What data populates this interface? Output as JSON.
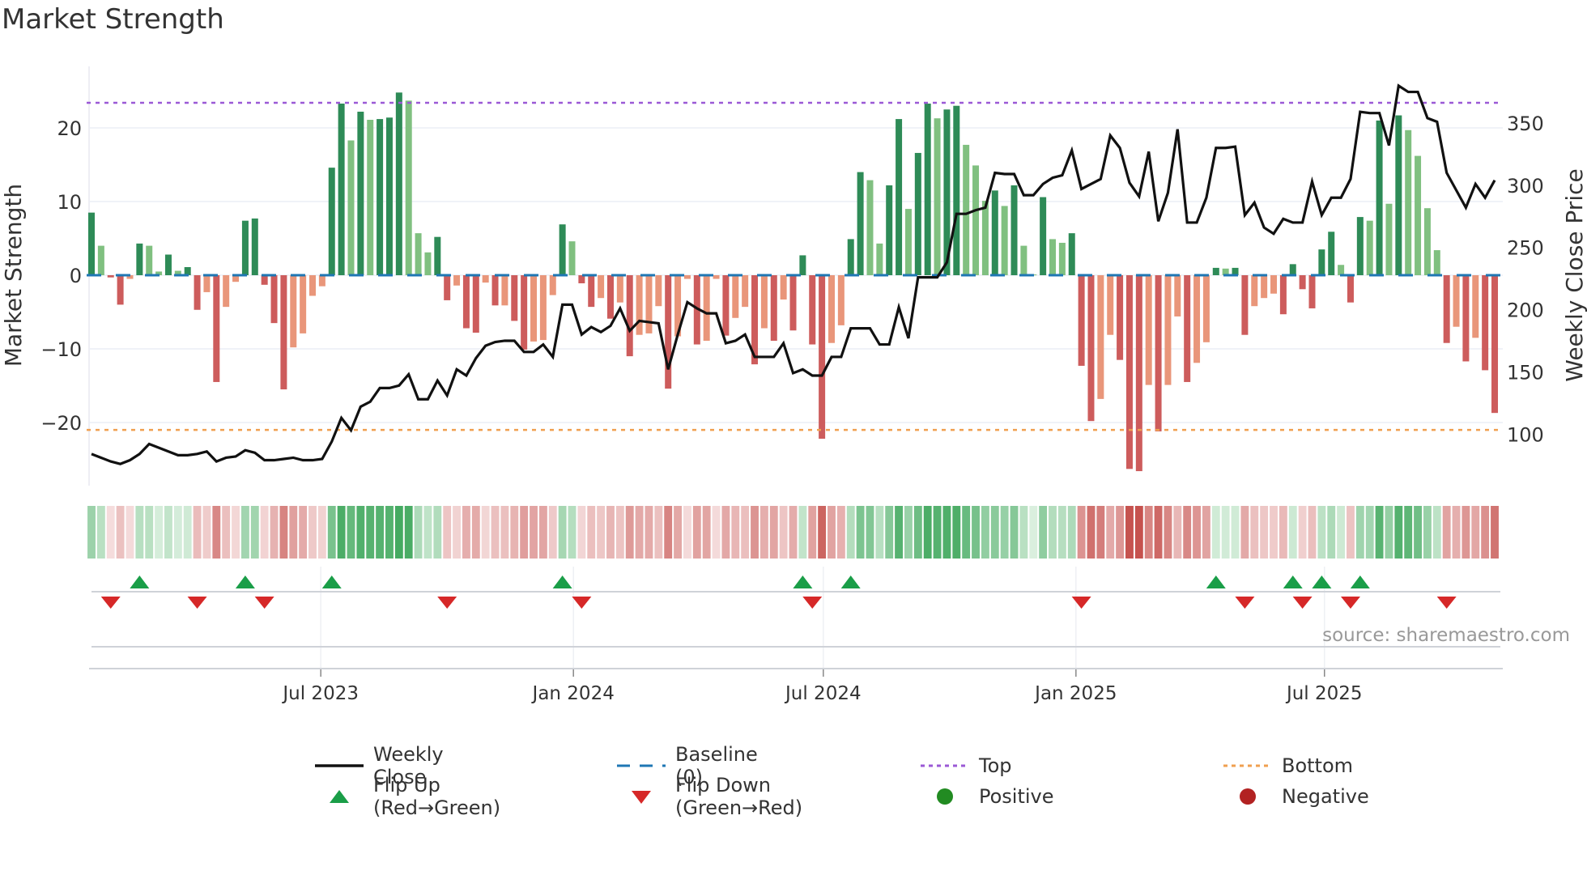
{
  "chart_data": {
    "type": "bar",
    "title": "Market Strength",
    "ylabel": "Market Strength",
    "y2label": "Weekly Close Price",
    "x_start": "2023-01-15",
    "x_interval": "weekly",
    "ylim": [
      -28,
      26
    ],
    "y2lim": [
      70,
      385
    ],
    "yticks": [
      {
        "v": 20,
        "label": "20"
      },
      {
        "v": 10,
        "label": "10"
      },
      {
        "v": 0,
        "label": "0"
      },
      {
        "v": -10,
        "label": "−10"
      },
      {
        "v": -20,
        "label": "−20"
      }
    ],
    "y2ticks": [
      {
        "v": 350,
        "label": "350"
      },
      {
        "v": 300,
        "label": "300"
      },
      {
        "v": 250,
        "label": "250"
      },
      {
        "v": 200,
        "label": "200"
      },
      {
        "v": 150,
        "label": "150"
      },
      {
        "v": 100,
        "label": "100"
      }
    ],
    "xticks": [
      {
        "date": "2023-07-01",
        "label": "Jul 2023"
      },
      {
        "date": "2024-01-01",
        "label": "Jan 2024"
      },
      {
        "date": "2024-07-01",
        "label": "Jul 2024"
      },
      {
        "date": "2025-01-01",
        "label": "Jan 2025"
      },
      {
        "date": "2025-07-01",
        "label": "Jul 2025"
      }
    ],
    "top_level": 23.4,
    "bottom_level": -21.0,
    "baseline": 0,
    "strength": [
      8.5,
      4,
      -0.3,
      -4,
      -0.5,
      4.3,
      4,
      0.5,
      2.8,
      0.6,
      1.1,
      -4.7,
      -2.3,
      -14.5,
      -4.3,
      -0.9,
      7.4,
      7.7,
      -1.3,
      -6.5,
      -15.5,
      -9.8,
      -7.9,
      -2.8,
      -1.5,
      14.6,
      23.3,
      18.3,
      22.2,
      21.1,
      21.2,
      21.4,
      24.8,
      23.7,
      5.7,
      3.1,
      5.2,
      -3.4,
      -1.4,
      -7.2,
      -7.8,
      -1,
      -4.1,
      -4.1,
      -6.2,
      -10.1,
      -9,
      -8.8,
      -2.7,
      6.9,
      4.6,
      -1.1,
      -4.3,
      -3.1,
      -5.9,
      -3.7,
      -11,
      -8.1,
      -7.9,
      -4.2,
      -15.4,
      -8.3,
      -0.5,
      -9.4,
      -8.9,
      -0.5,
      -8.2,
      -5.8,
      -4.3,
      -12.1,
      -7.2,
      -8.9,
      -3.3,
      -7.5,
      2.7,
      -9.4,
      -22.2,
      -9.2,
      -6.8,
      4.9,
      14,
      12.9,
      4.3,
      12.2,
      21.2,
      9,
      16.6,
      23.3,
      21.3,
      22.5,
      23,
      17.7,
      14.9,
      10.1,
      11.5,
      9.4,
      12.2,
      4,
      0.1,
      10.6,
      4.9,
      4.4,
      5.7,
      -12.3,
      -19.8,
      -16.8,
      -8.1,
      -11.5,
      -26.3,
      -26.6,
      -14.9,
      -21.2,
      -14.9,
      -5.6,
      -14.5,
      -11.9,
      -9.1,
      1,
      0.9,
      1,
      -8.1,
      -4.2,
      -3.1,
      -2.5,
      -5.3,
      1.5,
      -1.9,
      -4.5,
      3.5,
      5.9,
      1.4,
      -3.7,
      7.9,
      7.4,
      21,
      9.7,
      21.7,
      19.7,
      16.2,
      9.1,
      3.4,
      -9.2,
      -7,
      -11.7,
      -8.5,
      -12.9,
      -18.7
    ],
    "weekly_close": [
      84,
      81,
      78,
      76,
      79,
      84,
      92,
      89,
      86,
      83,
      83,
      84,
      86,
      78,
      81,
      82,
      87,
      85,
      79,
      79,
      80,
      81,
      79,
      79,
      80,
      94,
      113,
      103,
      122,
      126,
      137,
      137,
      139,
      148,
      128,
      128,
      143,
      131,
      152,
      147,
      161,
      171,
      174,
      175,
      175,
      166,
      166,
      172,
      162,
      204,
      204,
      180,
      186,
      182,
      187,
      201,
      183,
      191,
      190,
      189,
      152,
      180,
      206,
      201,
      197,
      197,
      173,
      175,
      180,
      162,
      162,
      162,
      173,
      149,
      152,
      147,
      147,
      162,
      162,
      185,
      185,
      185,
      172,
      172,
      202,
      177,
      226,
      226,
      226,
      238,
      277,
      277,
      280,
      282,
      310,
      309,
      309,
      292,
      292,
      301,
      306,
      308,
      328,
      297,
      301,
      305,
      340,
      330,
      302,
      291,
      327,
      271,
      294,
      345,
      270,
      270,
      290,
      330,
      330,
      331,
      276,
      286,
      266,
      261,
      273,
      270,
      270,
      303,
      276,
      290,
      290,
      305,
      359,
      358,
      358,
      332,
      380,
      375,
      375,
      354,
      351,
      310,
      296,
      282,
      301,
      290,
      304
    ],
    "legend": [
      {
        "key": "close",
        "label": "Weekly Close"
      },
      {
        "key": "baseline",
        "label": "Baseline (0)"
      },
      {
        "key": "top",
        "label": "Top"
      },
      {
        "key": "bottom",
        "label": "Bottom"
      },
      {
        "key": "flipup",
        "label": "Flip Up (Red→Green)"
      },
      {
        "key": "flipdown",
        "label": "Flip Down (Green→Red)"
      },
      {
        "key": "positive",
        "label": "Positive"
      },
      {
        "key": "negative",
        "label": "Negative"
      }
    ],
    "legend_position": "bottom",
    "colors": {
      "pos_strong": "#2e8b57",
      "pos_weak": "#80c080",
      "neg_strong": "#cd5c5c",
      "neg_weak": "#e9967a",
      "close": "#111111",
      "baseline": "#1f77b4",
      "top": "#9b59d6",
      "bottom": "#f0a050",
      "flipup": "#1a9e48",
      "flipdown": "#d62828",
      "positive": "#228b22",
      "negative": "#b22222"
    }
  },
  "source": "source: sharemaestro.com"
}
